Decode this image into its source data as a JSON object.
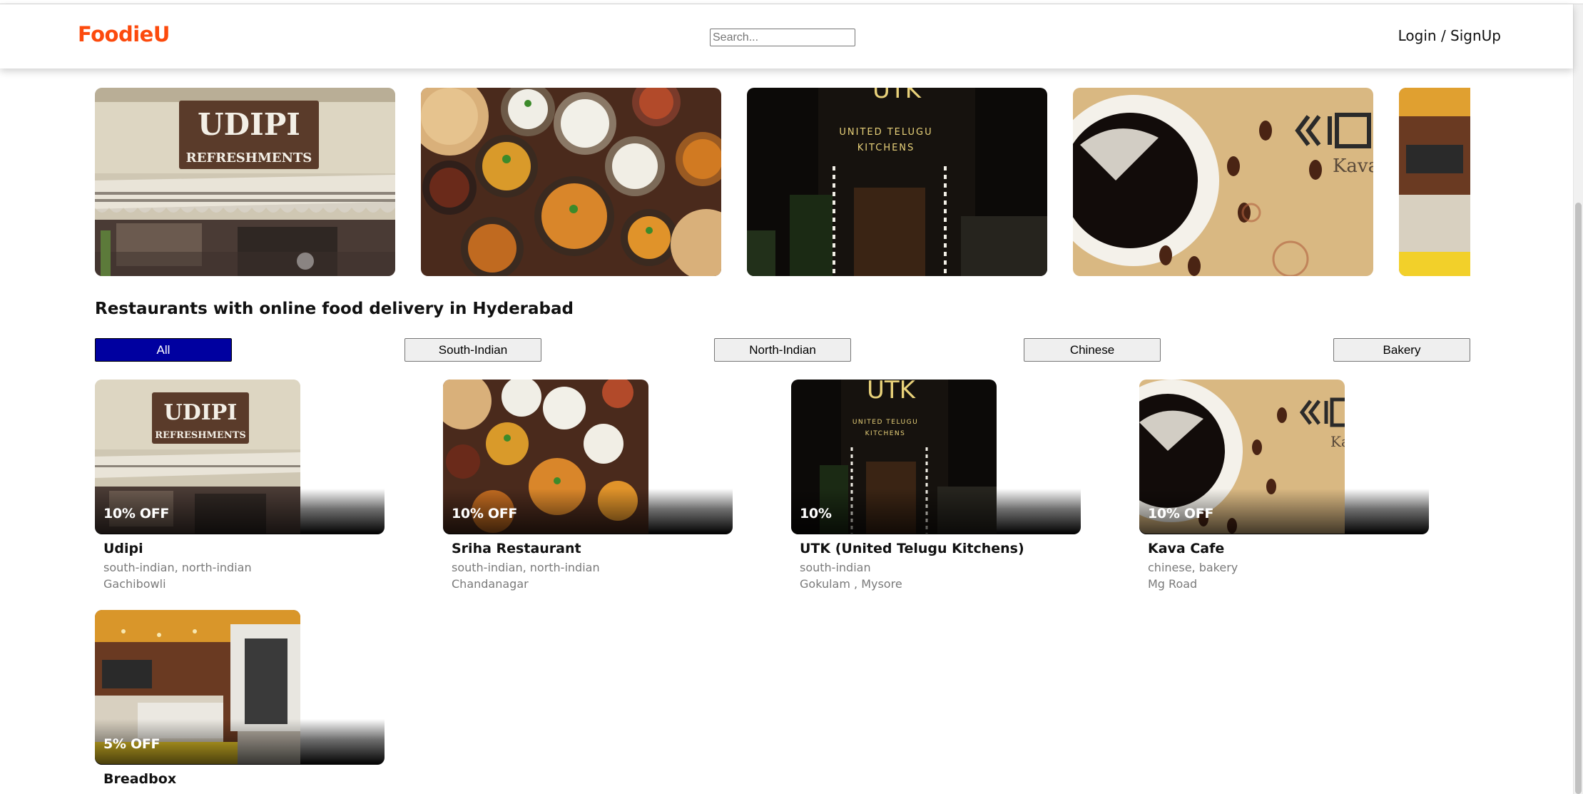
{
  "header": {
    "logo": "FoodieU",
    "search_placeholder": "Search...",
    "login": "Login / SignUp"
  },
  "carousel": {
    "slides": [
      {
        "name": "Udipi",
        "sign_line1": "UDIPI",
        "sign_line2": "REFRESHMENTS"
      },
      {
        "name": "Sriha Restaurant"
      },
      {
        "name": "UTK (United Telugu Kitchens)",
        "sign_top": "UTK",
        "sign_line1": "UNITED TELUGU",
        "sign_line2": "KITCHENS"
      },
      {
        "name": "Kava Cafe",
        "sign": "Kava"
      },
      {
        "name": "Breadbox"
      }
    ]
  },
  "section_title": "Restaurants with online food delivery in Hyderabad",
  "filters": [
    {
      "label": "All",
      "active": true
    },
    {
      "label": "South-Indian",
      "active": false
    },
    {
      "label": "North-Indian",
      "active": false
    },
    {
      "label": "Chinese",
      "active": false
    },
    {
      "label": "Bakery",
      "active": false
    }
  ],
  "restaurants": [
    {
      "name": "Udipi",
      "cuisine": "south-indian, north-indian",
      "location": "Gachibowli",
      "offer": "10% OFF"
    },
    {
      "name": "Sriha Restaurant",
      "cuisine": "south-indian, north-indian",
      "location": "Chandanagar",
      "offer": "10% OFF"
    },
    {
      "name": "UTK (United Telugu Kitchens)",
      "cuisine": "south-indian",
      "location": "Gokulam , Mysore",
      "offer": "10%"
    },
    {
      "name": "Kava Cafe",
      "cuisine": "chinese, bakery",
      "location": "Mg Road",
      "offer": "10% OFF"
    },
    {
      "name": "Breadbox",
      "cuisine": "",
      "location": "",
      "offer": "5% OFF"
    }
  ],
  "colors": {
    "brand": "#fc4a0d",
    "active_filter": "#0000a0"
  }
}
